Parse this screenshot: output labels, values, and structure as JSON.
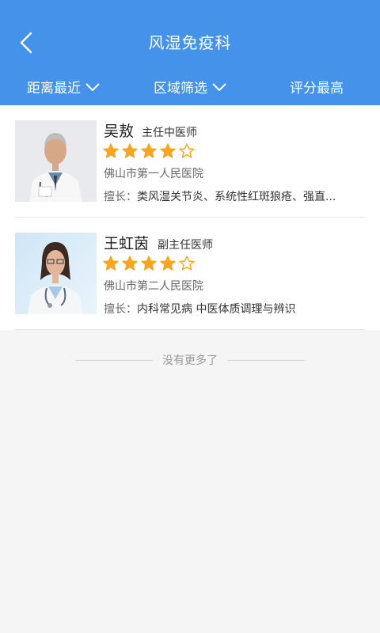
{
  "header": {
    "title": "风湿免疫科",
    "back_icon": "chevron-left-icon",
    "filters": [
      {
        "label": "距离最近",
        "icon": "chevron-down-icon"
      },
      {
        "label": "区域筛选",
        "icon": "chevron-down-icon"
      },
      {
        "label": "评分最高"
      }
    ]
  },
  "doctors": [
    {
      "name": "吴敖",
      "title": "主任中医师",
      "rating": 4,
      "max_rating": 5,
      "hospital": "佛山市第一人民医院",
      "skill_label": "擅长：",
      "skill": "类风湿关节炎、系统性红斑狼疮、强直..."
    },
    {
      "name": "王虹茵",
      "title": "副主任医师",
      "rating": 4,
      "max_rating": 5,
      "hospital": "佛山市第二人民医院",
      "skill_label": "擅长：",
      "skill": "内科常见病 中医体质调理与辨识"
    }
  ],
  "footer": {
    "no_more": "没有更多了"
  },
  "colors": {
    "primary": "#4492ea",
    "star": "#f6a623"
  }
}
